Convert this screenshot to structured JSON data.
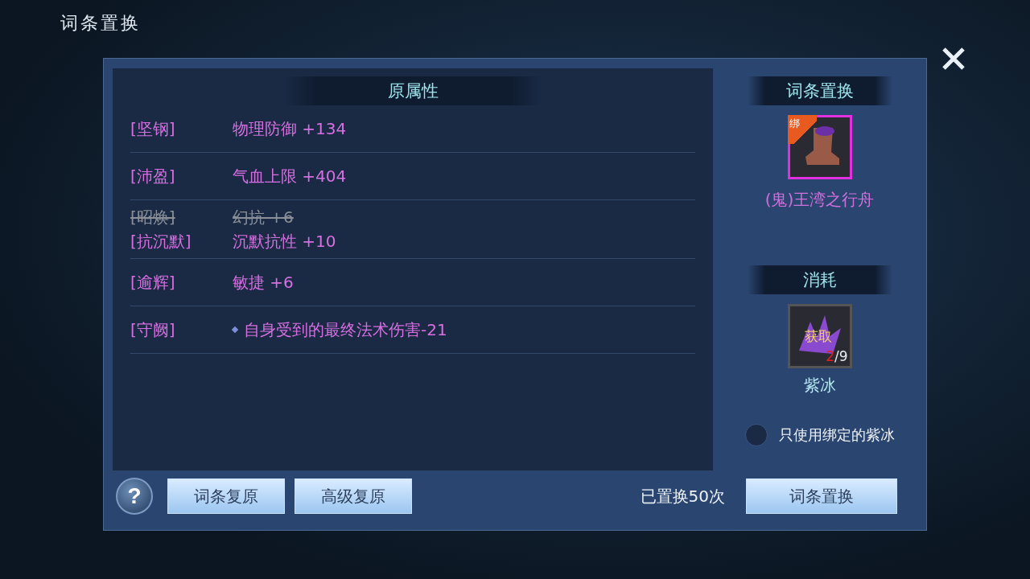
{
  "window": {
    "title": "词条置换"
  },
  "attributes": {
    "header": "原属性",
    "groups": [
      {
        "lines": [
          {
            "tag": "[坚钢]",
            "text": "物理防御 +134",
            "struck": false,
            "bullet": false
          }
        ]
      },
      {
        "lines": [
          {
            "tag": "[沛盈]",
            "text": "气血上限 +404",
            "struck": false,
            "bullet": false
          }
        ]
      },
      {
        "lines": [
          {
            "tag": "[昭焕]",
            "text": "幻抗 +6",
            "struck": true,
            "bullet": false
          },
          {
            "tag": "[抗沉默]",
            "text": "沉默抗性 +10",
            "struck": false,
            "bullet": false
          }
        ]
      },
      {
        "lines": [
          {
            "tag": "[逾辉]",
            "text": "敏捷 +6",
            "struck": false,
            "bullet": false
          }
        ]
      },
      {
        "lines": [
          {
            "tag": "[守阙]",
            "text": "自身受到的最终法术伤害-21",
            "struck": false,
            "bullet": true
          }
        ]
      }
    ]
  },
  "item": {
    "header": "词条置换",
    "badge": "绑",
    "name": "(鬼)王湾之行舟"
  },
  "cost": {
    "header": "消耗",
    "label": "获取",
    "count_have": "2",
    "count_total": "/9",
    "name": "紫冰"
  },
  "bind_option": {
    "label": "只使用绑定的紫冰",
    "checked": false
  },
  "footer": {
    "buttons": [
      "词条复原",
      "高级复原"
    ],
    "help": "?",
    "count_text": "已置换50次",
    "action": "词条置换"
  }
}
